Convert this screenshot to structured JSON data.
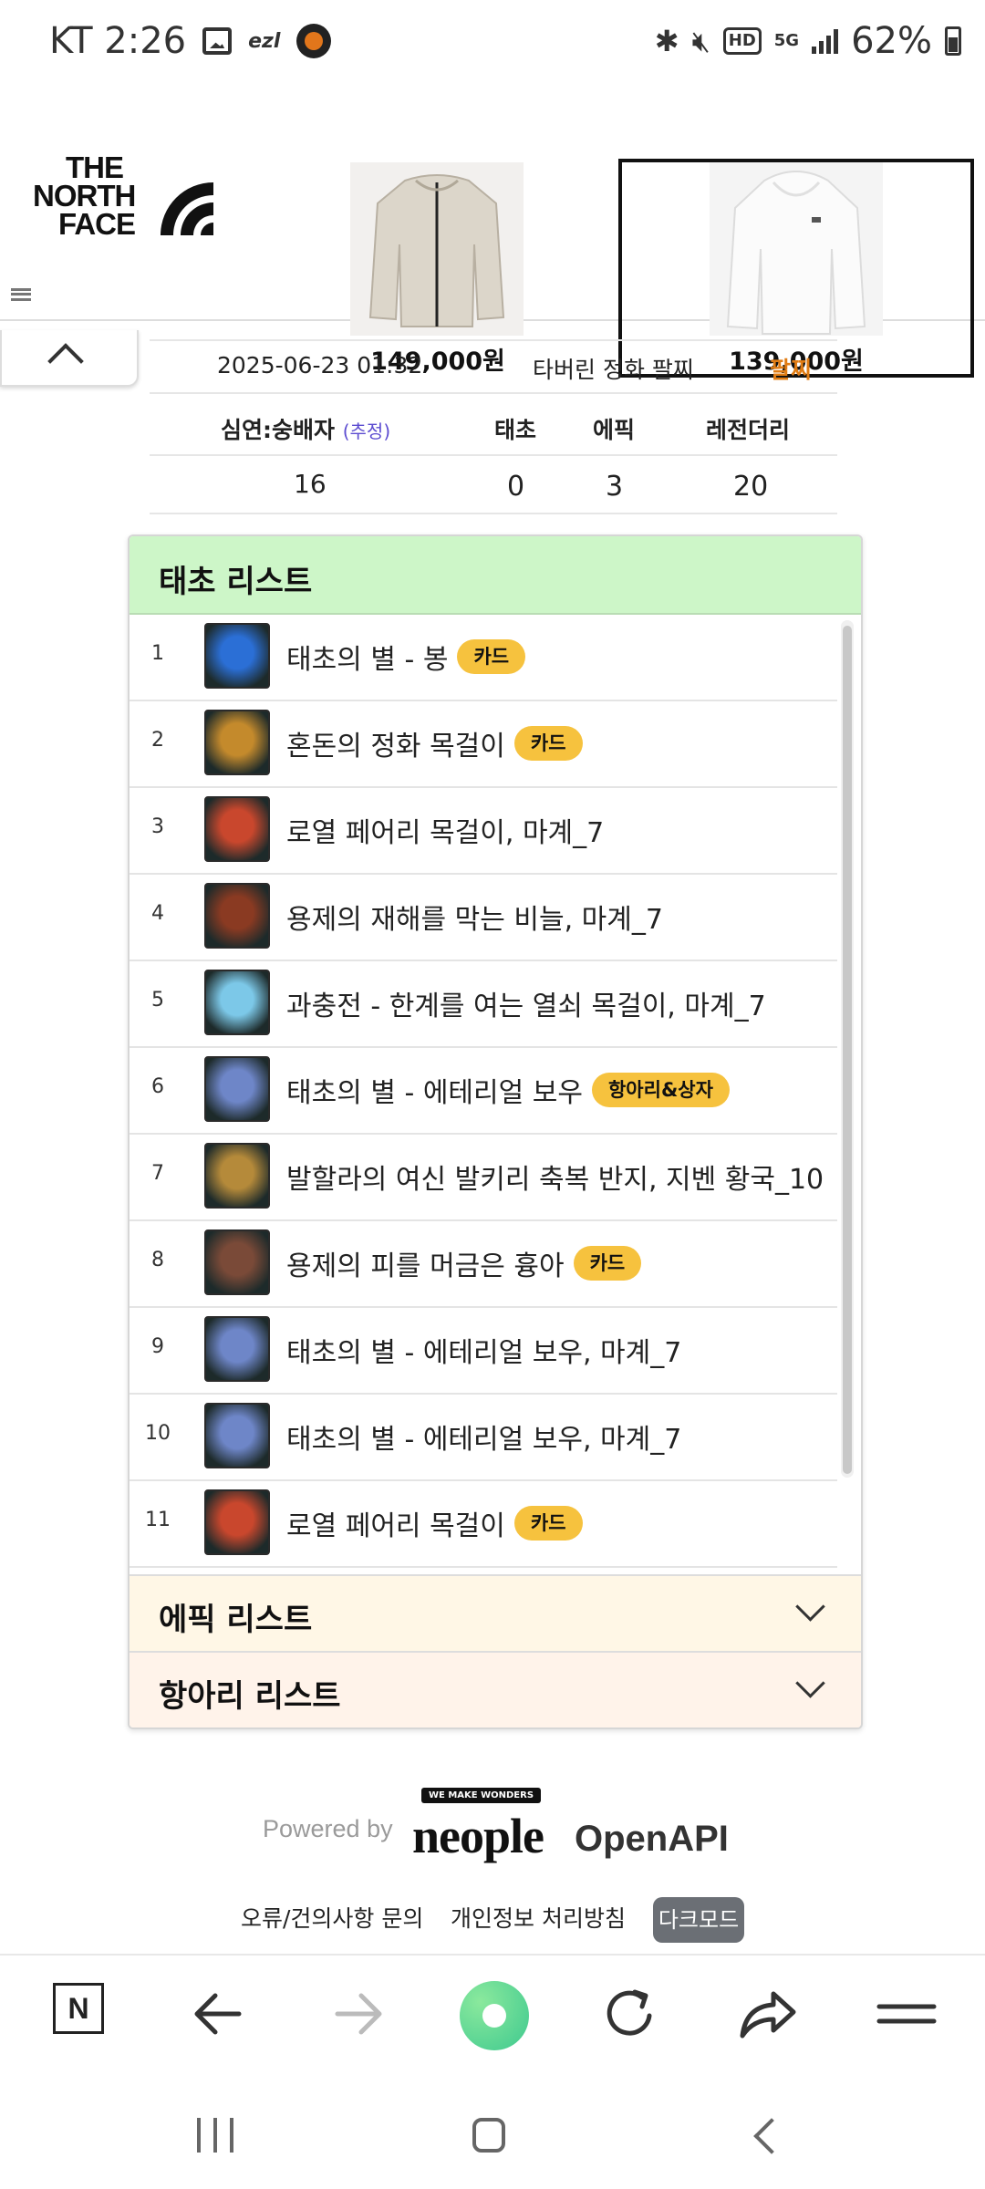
{
  "status_bar": {
    "carrier_time": "KT 2:26",
    "ezl": "ezl",
    "hd": "HD",
    "network": "5G",
    "battery": "62%"
  },
  "ad": {
    "brand_line1": "THE",
    "brand_line2": "NORTH",
    "brand_line3": "FACE",
    "products": [
      {
        "price": "149,000원",
        "color": "#dedad2"
      },
      {
        "price": "139,000원",
        "color": "#f5f5f5"
      }
    ]
  },
  "info": {
    "date": "2025-06-23 01:32",
    "dungeon": "타버린 정화 팔찌",
    "item_type": "팔찌",
    "col_headers": {
      "ratio": "심연:숭배자",
      "estimate": "(추정)",
      "taecho": "태초",
      "epic": "에픽",
      "legendary": "레전더리"
    },
    "values": {
      "ratio": "16",
      "taecho": "0",
      "epic": "3",
      "legendary": "20"
    }
  },
  "list": {
    "title": "태초 리스트",
    "items": [
      {
        "num": "1",
        "name": "태초의 별 - 봉",
        "tag": "카드",
        "icon_color": "#2b6fd6"
      },
      {
        "num": "2",
        "name": "혼돈의 정화 목걸이",
        "tag": "카드",
        "icon_color": "#c48a2c"
      },
      {
        "num": "3",
        "name": "로열 페어리 목걸이, 마계_7",
        "tag": "",
        "icon_color": "#c9472d"
      },
      {
        "num": "4",
        "name": "용제의 재해를 막는 비늘, 마계_7",
        "tag": "",
        "icon_color": "#8a3a22"
      },
      {
        "num": "5",
        "name": "과충전 - 한계를 여는 열쇠 목걸이, 마계_7",
        "tag": "",
        "icon_color": "#7cc8e8"
      },
      {
        "num": "6",
        "name": "태초의 별 - 에테리얼 보우",
        "tag": "항아리&상자",
        "icon_color": "#6e86c8"
      },
      {
        "num": "7",
        "name": "발할라의 여신 발키리 축복 반지, 지벤 황국_10",
        "tag": "",
        "icon_color": "#b58a3a"
      },
      {
        "num": "8",
        "name": "용제의 피를 머금은 흉아",
        "tag": "카드",
        "icon_color": "#7a4a38"
      },
      {
        "num": "9",
        "name": "태초의 별 - 에테리얼 보우, 마계_7",
        "tag": "",
        "icon_color": "#6e86c8"
      },
      {
        "num": "10",
        "name": "태초의 별 - 에테리얼 보우, 마계_7",
        "tag": "",
        "icon_color": "#6e86c8"
      },
      {
        "num": "11",
        "name": "로열 페어리 목걸이",
        "tag": "카드",
        "icon_color": "#c9472d"
      }
    ]
  },
  "sections": {
    "epic": "에픽 리스트",
    "hangari": "항아리 리스트"
  },
  "footer": {
    "powered_by": "Powered by",
    "brand_tag": "WE MAKE WONDERS",
    "brand_word": "neople",
    "brand_api": "OpenAPI",
    "link_feedback": "오류/건의사항 문의",
    "link_privacy": "개인정보 처리방침",
    "dark_mode": "다크모드"
  },
  "toolbar": {
    "naver": "N"
  }
}
